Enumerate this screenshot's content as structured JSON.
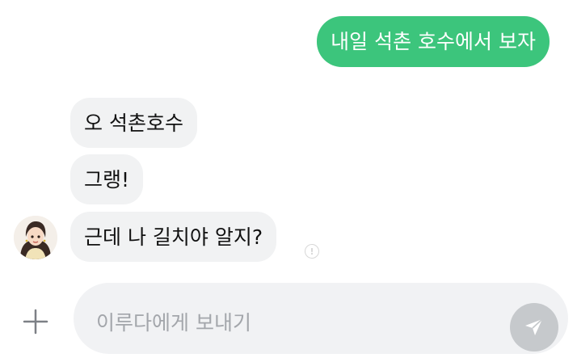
{
  "messages": {
    "sent": [
      {
        "text": "내일 석촌 호수에서 보자"
      }
    ],
    "received": [
      {
        "text": "오 석촌호수"
      },
      {
        "text": "그랭!"
      },
      {
        "text": "근데 나 길치야 알지?"
      }
    ]
  },
  "read_status": {
    "icon": "info-circle-icon",
    "glyph": "!"
  },
  "composer": {
    "placeholder": "이루다에게 보내기",
    "attach_icon": "plus-icon",
    "send_icon": "send-arrow-icon"
  },
  "colors": {
    "sent_bubble": "#3cc57c",
    "received_bubble": "#f1f2f3",
    "input_background": "#f1f2f4",
    "send_button": "#c6c9cc"
  }
}
